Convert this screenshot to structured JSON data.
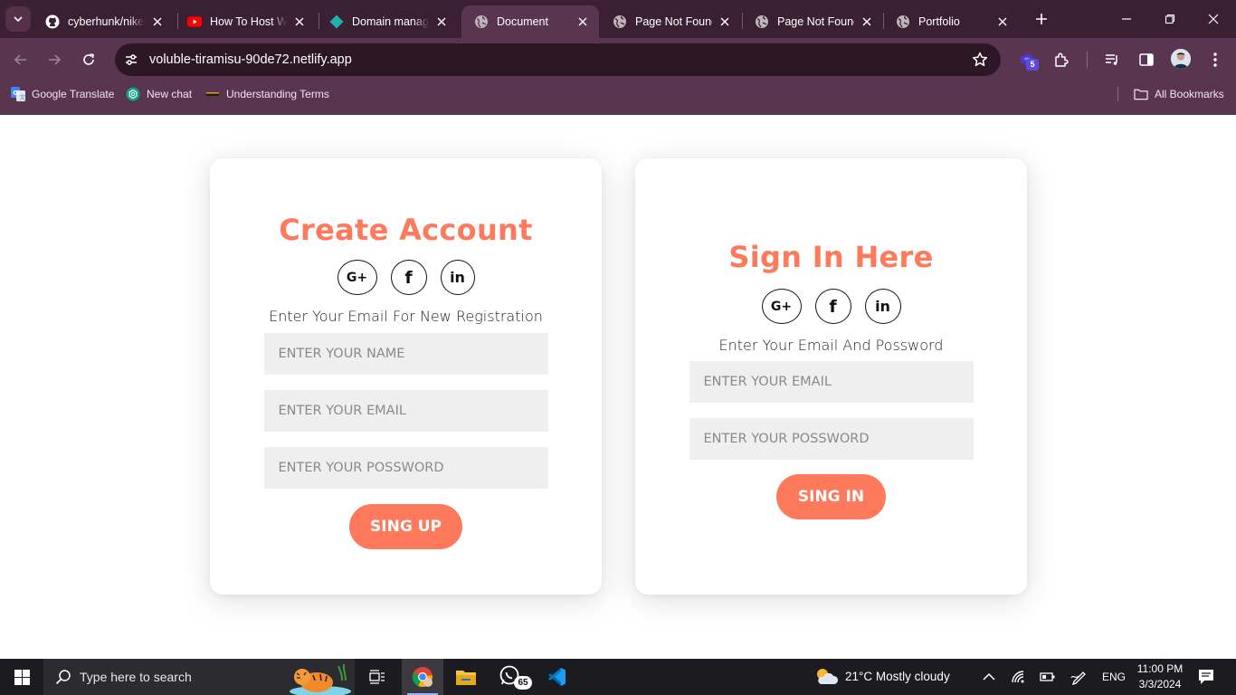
{
  "browser": {
    "tabs": [
      {
        "title": "cyberhunk/nike-",
        "icon": "github-icon"
      },
      {
        "title": "How To Host We",
        "icon": "youtube-icon"
      },
      {
        "title": "Domain manage",
        "icon": "netlify-icon"
      },
      {
        "title": "Document",
        "icon": "globe-icon",
        "active": true
      },
      {
        "title": "Page Not Found",
        "icon": "globe-icon"
      },
      {
        "title": "Page Not Found",
        "icon": "globe-icon"
      },
      {
        "title": "Portfolio",
        "icon": "globe-icon"
      }
    ],
    "url": "voluble-tiramisu-90de72.netlify.app",
    "extension_badge": "5",
    "bookmarks": [
      {
        "label": "Google Translate",
        "icon": "google-translate-icon"
      },
      {
        "label": "New chat",
        "icon": "chatgpt-icon"
      },
      {
        "label": "Understanding Terms",
        "icon": "bookmark-icon"
      }
    ],
    "all_bookmarks_label": "All Bookmarks"
  },
  "signup": {
    "title": "Create Account",
    "social": [
      "G+",
      "f",
      "in"
    ],
    "hint": "Enter Your Email For New Registration",
    "name_placeholder": "ENTER YOUR NAME",
    "email_placeholder": "ENTER YOUR EMAIL",
    "password_placeholder": "ENTER YOUR POSSWORD",
    "button": "SING UP"
  },
  "signin": {
    "title": "Sign In Here",
    "social": [
      "G+",
      "f",
      "in"
    ],
    "hint": "Enter Your Email And Possword",
    "email_placeholder": "ENTER YOUR EMAIL",
    "password_placeholder": "ENTER YOUR POSSWORD",
    "button": "SING IN"
  },
  "colors": {
    "accent": "#ff7a5c",
    "chrome_dark": "#3b1f33",
    "chrome": "#5a3550",
    "field_bg": "#efefef"
  },
  "taskbar": {
    "search_placeholder": "Type here to search",
    "whatsapp_badge": "65",
    "weather": "21°C  Mostly cloudy",
    "language": "ENG",
    "time": "11:00 PM",
    "date": "3/3/2024"
  }
}
